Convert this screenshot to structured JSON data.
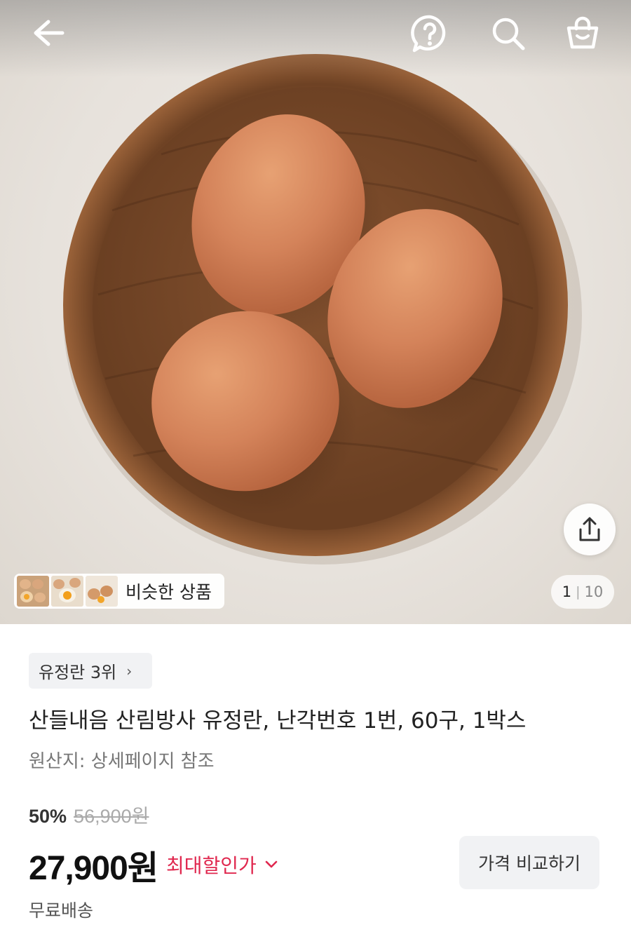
{
  "header": {
    "back_icon": "arrow-left-icon",
    "help_icon": "question-bubble-icon",
    "search_icon": "search-icon",
    "cart_icon": "shopping-bag-icon"
  },
  "gallery": {
    "current_page": "1",
    "total_pages": "10",
    "separator": "|",
    "similar_label": "비슷한 상품",
    "share_icon": "share-icon"
  },
  "product": {
    "rank_label": "유정란 3위",
    "rank_chevron": "›",
    "title": "산들내음 산림방사 유정란, 난각번호 1번, 60구, 1박스",
    "origin": "원산지: 상세페이지 참조",
    "discount_rate": "50%",
    "original_price": "56,900원",
    "sale_price": "27,900원",
    "max_discount_label": "최대할인가",
    "compare_button": "가격 비교하기",
    "shipping": "무료배송"
  },
  "colors": {
    "accent_red": "#e0284f",
    "chip_bg": "#f1f2f4"
  }
}
